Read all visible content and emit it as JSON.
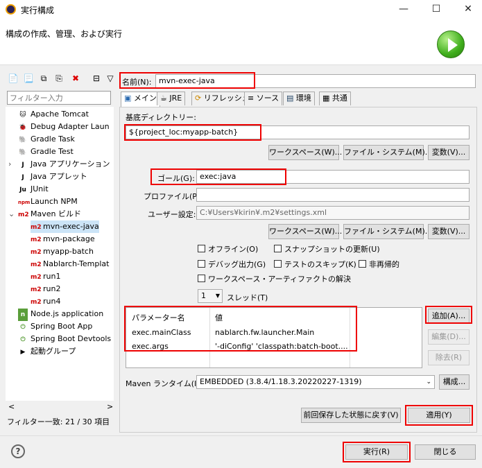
{
  "window": {
    "title": "実行構成",
    "minimize": "—",
    "maximize": "☐",
    "close": "✕"
  },
  "header": {
    "subtitle": "構成の作成、管理、および実行"
  },
  "toolbar": {
    "new": "📄",
    "export": "📃",
    "duplicate": "⧉",
    "copy": "⎘",
    "delete": "✖",
    "collapse": "⊟",
    "filter": "▽"
  },
  "filter": {
    "placeholder": "フィルター入力"
  },
  "tree": [
    {
      "label": "Apache Tomcat",
      "icon": "tomcat-icon",
      "glyph": "🐱",
      "level": 1
    },
    {
      "label": "Debug Adapter Laun",
      "icon": "debug-adapter-icon",
      "glyph": "🐞",
      "level": 1
    },
    {
      "label": "Gradle Task",
      "icon": "gradle-icon",
      "glyph": "🐘",
      "level": 1
    },
    {
      "label": "Gradle Test",
      "icon": "gradle-icon",
      "glyph": "🐘",
      "level": 1
    },
    {
      "label": "Java アプリケーション",
      "icon": "java-app-icon",
      "glyph": "J",
      "level": 1,
      "expander": "›"
    },
    {
      "label": "Java アプレット",
      "icon": "java-applet-icon",
      "glyph": "J",
      "level": 1
    },
    {
      "label": "JUnit",
      "icon": "junit-icon",
      "glyph": "Ju",
      "level": 1
    },
    {
      "label": "Launch NPM",
      "icon": "npm-icon",
      "glyph": "npm",
      "level": 1
    },
    {
      "label": "Maven ビルド",
      "icon": "maven-icon",
      "glyph": "m2",
      "level": 1,
      "expander": "⌄"
    },
    {
      "label": "mvn-exec-java",
      "icon": "maven-icon",
      "glyph": "m2",
      "level": 2,
      "selected": true
    },
    {
      "label": "mvn-package",
      "icon": "maven-icon",
      "glyph": "m2",
      "level": 2
    },
    {
      "label": "myapp-batch",
      "icon": "maven-icon",
      "glyph": "m2",
      "level": 2
    },
    {
      "label": "Nablarch-Templat",
      "icon": "maven-icon",
      "glyph": "m2",
      "level": 2
    },
    {
      "label": "run1",
      "icon": "maven-icon",
      "glyph": "m2",
      "level": 2
    },
    {
      "label": "run2",
      "icon": "maven-icon",
      "glyph": "m2",
      "level": 2
    },
    {
      "label": "run4",
      "icon": "maven-icon",
      "glyph": "m2",
      "level": 2
    },
    {
      "label": "Node.js application",
      "icon": "nodejs-icon",
      "glyph": "n",
      "level": 1
    },
    {
      "label": "Spring Boot App",
      "icon": "spring-icon",
      "glyph": "⏻",
      "level": 1
    },
    {
      "label": "Spring Boot Devtools",
      "icon": "spring-icon",
      "glyph": "⏻",
      "level": 1
    },
    {
      "label": "起動グループ",
      "icon": "launch-group-icon",
      "glyph": "▶",
      "level": 1
    }
  ],
  "tree_scroll": {
    "left": "<",
    "right": ">"
  },
  "filter_count": "フィルター一致: 21 / 30 項目",
  "config": {
    "name_label": "名前(N):",
    "name_value": "mvn-exec-java",
    "tabs": [
      "メイン",
      "JRE",
      "リフレッシュ",
      "ソース",
      "環境",
      "共通"
    ],
    "basedir_label": "基底ディレクトリー:",
    "basedir_value": "${project_loc:myapp-batch}",
    "workspace_btn": "ワークスペース(W)...",
    "filesystem_btn": "ファイル・システム(M)...",
    "variables_btn": "変数(V)...",
    "goal_label": "ゴール(G):",
    "goal_value": "exec:java",
    "profile_label": "プロファイル(P):",
    "profile_value": "",
    "user_settings_label": "ユーザー設定:",
    "user_settings_value": "C:¥Users¥kirin¥.m2¥settings.xml",
    "offline": "オフライン(O)",
    "update_snapshots": "スナップショットの更新(U)",
    "debug_output": "デバッグ出力(G)",
    "skip_tests": "テストのスキップ(K)",
    "non_recursive": "非再帰的",
    "resolve_workspace": "ワークスペース・アーティファクトの解決",
    "threads_value": "1",
    "threads_label": "スレッド(T)",
    "params_header_name": "パラメーター名",
    "params_header_value": "値",
    "params": [
      {
        "name": "exec.mainClass",
        "value": "nablarch.fw.launcher.Main"
      },
      {
        "name": "exec.args",
        "value": "'-diConfig' 'classpath:batch-boot...."
      }
    ],
    "add_btn": "追加(A)...",
    "edit_btn": "編集(D)...",
    "remove_btn": "除去(R)",
    "maven_runtime_label": "Maven ランタイム(I):",
    "maven_runtime_value": "EMBEDDED (3.8.4/1.18.3.20220227-1319)",
    "configure_btn": "構成...",
    "revert_btn": "前回保存した状態に戻す(V)",
    "apply_btn": "適用(Y)"
  },
  "footer": {
    "help": "?",
    "run_btn": "実行(R)",
    "close_btn": "閉じる"
  }
}
